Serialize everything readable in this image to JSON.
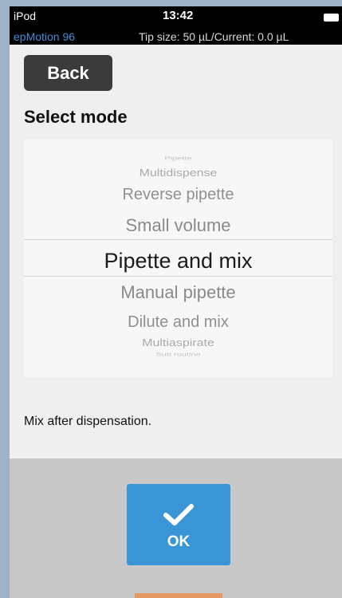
{
  "status_bar": {
    "carrier": "iPod",
    "time": "13:42",
    "app_name": "epMotion 96",
    "tip_info": "Tip size:  50 µL/Current:   0.0 µL",
    "app_name_color": "#3f8ed8"
  },
  "header": {
    "back_label": "Back",
    "title": "Select mode"
  },
  "picker": {
    "items": [
      "Pipette",
      "Multidispense",
      "Reverse pipette",
      "Small volume",
      "Pipette and mix",
      "Manual pipette",
      "Dilute and mix",
      "Multiaspirate",
      "Sub routine"
    ],
    "selected": "Pipette and mix"
  },
  "description": "Mix after dispensation.",
  "footer": {
    "ok_label": "OK",
    "ok_icon": "checkmark-icon",
    "accent_color": "#3a95d6"
  }
}
